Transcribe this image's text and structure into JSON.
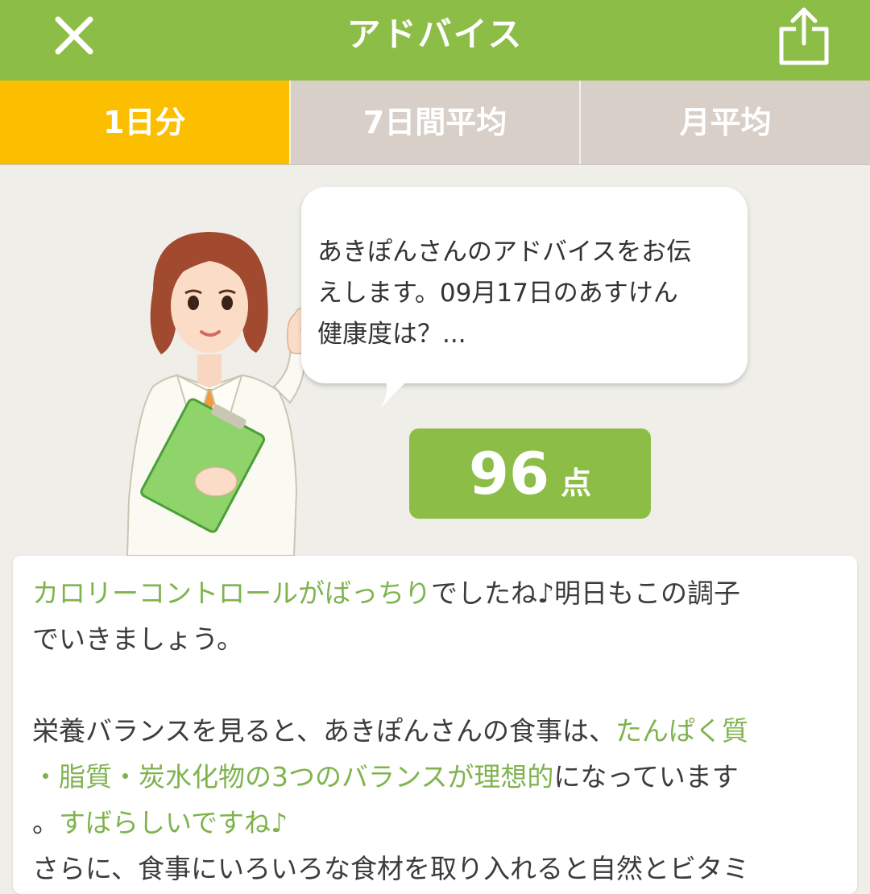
{
  "header": {
    "title": "アドバイス",
    "close_icon": "close-icon",
    "share_icon": "share-icon",
    "color": "#8cbd46"
  },
  "tabs": [
    {
      "label": "1日分",
      "active": true
    },
    {
      "label": "7日間平均",
      "active": false
    },
    {
      "label": "月平均",
      "active": false
    }
  ],
  "bubble": {
    "lines": [
      "あきぽんさんのアドバイスをお伝",
      "えします。09月17日のあすけん",
      "健康度は？..."
    ]
  },
  "score": {
    "value": "96",
    "unit": "点"
  },
  "advice": {
    "p1_line1_highlight": "カロリーコントロールがばっちり",
    "p1_line1_rest": "でしたね♪明日もこの調子",
    "p1_line2": "でいきましょう。",
    "p2_line1_text": "栄養バランスを見ると、あきぽんさんの食事は、",
    "p2_line1_highlight": "たんぱく質",
    "p2_line2_highlight": "・脂質・炭水化物の3つのバランスが理想的",
    "p2_line2_rest": "になっています",
    "p2_line3_text": "。",
    "p2_line3_highlight": "すばらしいですね♪",
    "p3_line1": "さらに、食事にいろいろな食材を取り入れると自然とビタミ"
  },
  "colors": {
    "accent_green": "#8cbd46",
    "tab_active": "#fbbf00",
    "tab_inactive": "#d8d0c8",
    "highlight_text": "#7fb34e"
  }
}
